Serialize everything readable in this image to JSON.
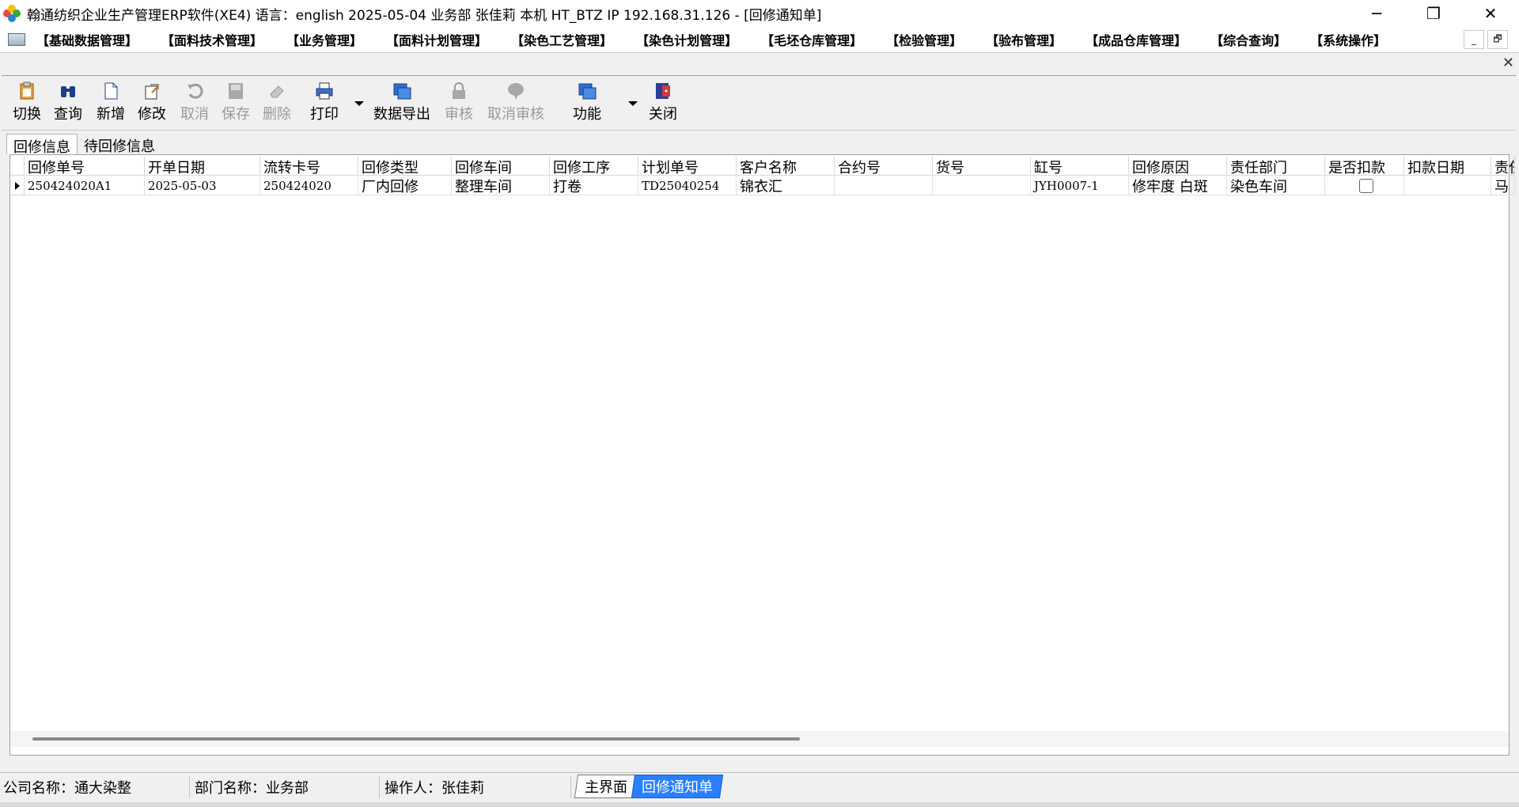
{
  "window": {
    "title": "翰通纺织企业生产管理ERP软件(XE4)  语言：english  2025-05-04  业务部 张佳莉 本机 HT_BTZ IP 192.168.31.126 - [回修通知单]",
    "minimize": "─",
    "restore": "❐",
    "close": "✕"
  },
  "menu": {
    "items": [
      "【基础数据管理】",
      "【面料技术管理】",
      "【业务管理】",
      "【面料计划管理】",
      "【染色工艺管理】",
      "【染色计划管理】",
      "【毛坯仓库管理】",
      "【检验管理】",
      "【验布管理】",
      "【成品仓库管理】",
      "【综合查询】",
      "【系统操作】"
    ],
    "mdi_minimize": "_",
    "mdi_restore": "🗗",
    "mdi_close": "✕"
  },
  "toolbar": {
    "switch": "切换",
    "query": "查询",
    "add": "新增",
    "edit": "修改",
    "cancel": "取消",
    "save": "保存",
    "delete": "删除",
    "print": "打印",
    "export": "数据导出",
    "audit": "审核",
    "unaudit": "取消审核",
    "function": "功能",
    "close": "关闭"
  },
  "tabs": [
    "回修信息",
    "待回修信息"
  ],
  "grid": {
    "columns": [
      "回修单号",
      "开单日期",
      "流转卡号",
      "回修类型",
      "回修车间",
      "回修工序",
      "计划单号",
      "客户名称",
      "合约号",
      "货号",
      "缸号",
      "回修原因",
      "责任部门",
      "是否扣款",
      "扣款日期",
      "责任"
    ],
    "rows": [
      [
        "250424020A1",
        "2025-05-03",
        "250424020",
        "厂内回修",
        "整理车间",
        "打卷",
        "TD25040254",
        "锦衣汇",
        "",
        "",
        "JYH0007-1",
        "修牢度 白斑",
        "染色车间",
        "",
        "",
        "马"
      ]
    ]
  },
  "status": {
    "company": "公司名称：通大染整",
    "department": "部门名称：业务部",
    "operator": "操作人：张佳莉",
    "tab_main": "主界面",
    "tab_active": "回修通知单"
  }
}
